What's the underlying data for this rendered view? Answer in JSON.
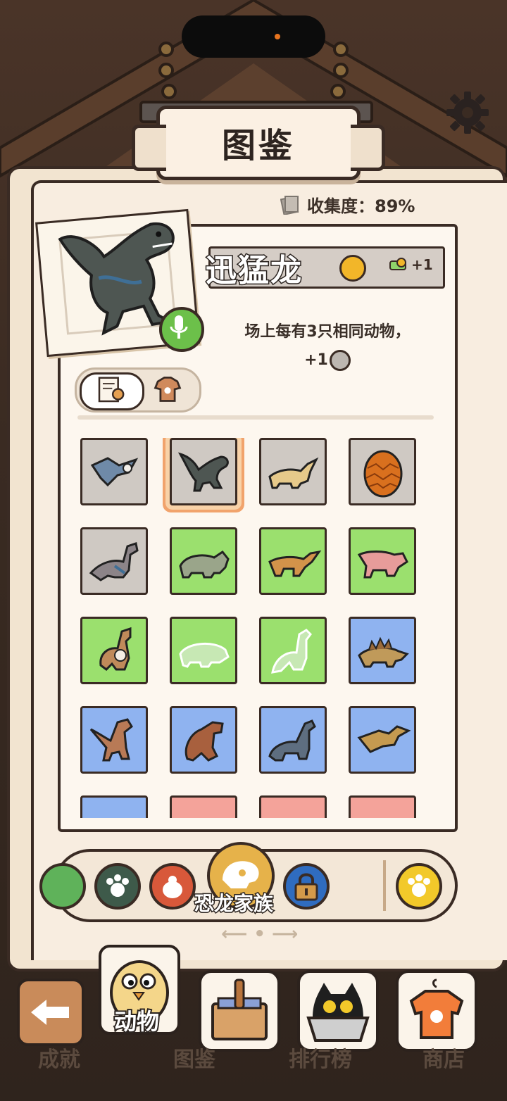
{
  "header": {
    "title": "图鉴"
  },
  "collection": {
    "label": "收集度：89%"
  },
  "detail": {
    "name": "迅猛龙",
    "bonus": "+1",
    "description_line1": "场上每有3只相同动物，",
    "description_line2": "+1"
  },
  "category": {
    "label": "恐龙家族"
  },
  "pager": {
    "indicator": "⟵ • ⟶"
  },
  "nav": {
    "animals_label": "动物",
    "achievements_label": "成就",
    "codex_label": "图鉴",
    "ranking_label": "排行榜",
    "shop_label": "商店"
  },
  "grid": {
    "rows": [
      [
        "gray",
        "gray",
        "gray",
        "gray"
      ],
      [
        "gray",
        "green",
        "green",
        "green"
      ],
      [
        "green",
        "green",
        "green",
        "blue"
      ],
      [
        "blue",
        "blue",
        "blue",
        "blue"
      ],
      [
        "blue",
        "red",
        "red",
        "red"
      ]
    ],
    "selected": "1"
  },
  "colors": {
    "accent": "#f1a36c",
    "green_rarity": "#9be06e",
    "blue_rarity": "#8fb3f0",
    "red_rarity": "#f4a39a",
    "gray_rarity": "#cfc9c3"
  }
}
